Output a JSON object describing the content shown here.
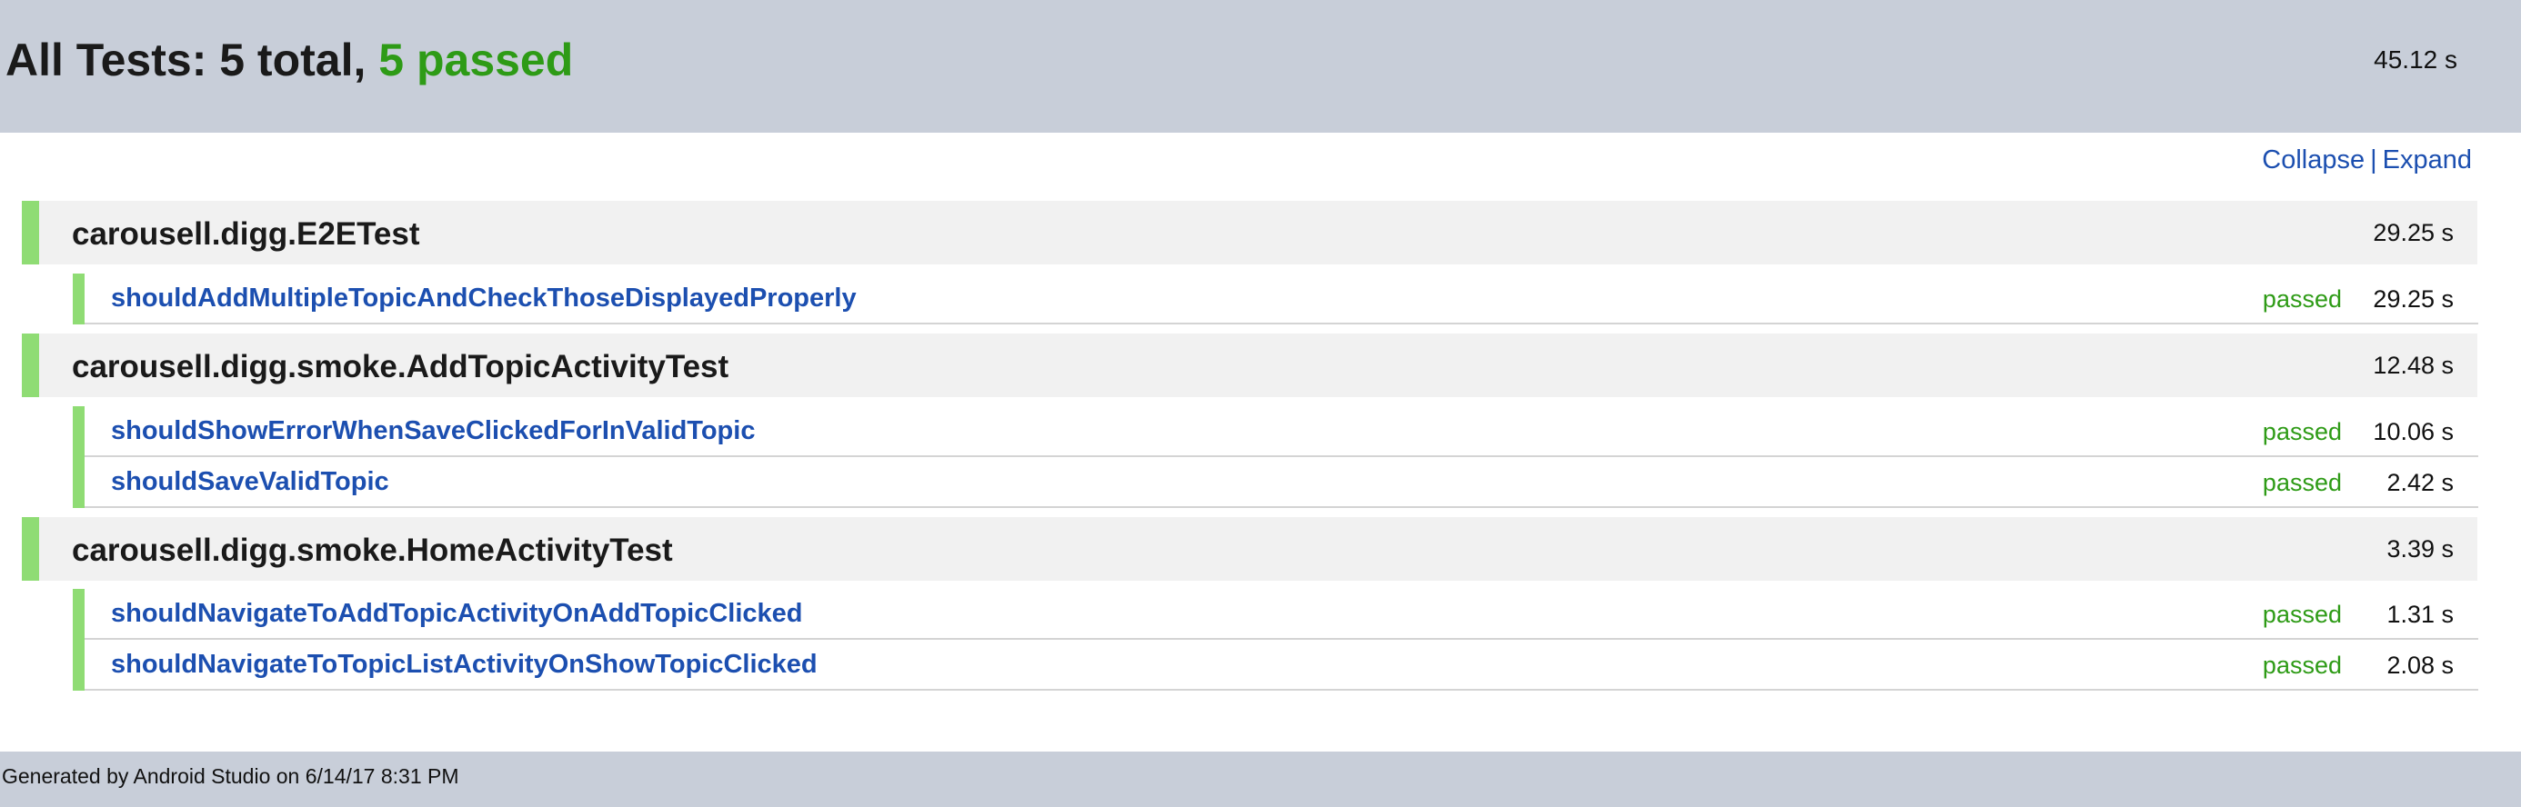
{
  "header": {
    "title_prefix": "All Tests: 5 total, ",
    "title_passed": "5 passed",
    "total_time": "45.12 s"
  },
  "controls": {
    "collapse": "Collapse",
    "separator": "|",
    "expand": "Expand"
  },
  "colors": {
    "passed": "#2e9b16",
    "link": "#1c4fb0",
    "status_bar": "#8fdc74",
    "header_bg": "#c8ced9"
  },
  "suites": [
    {
      "name": "carousell.digg.E2ETest",
      "time": "29.25 s",
      "tests": [
        {
          "name": "shouldAddMultipleTopicAndCheckThoseDisplayedProperly",
          "status": "passed",
          "time": "29.25 s"
        }
      ]
    },
    {
      "name": "carousell.digg.smoke.AddTopicActivityTest",
      "time": "12.48 s",
      "tests": [
        {
          "name": "shouldShowErrorWhenSaveClickedForInValidTopic",
          "status": "passed",
          "time": "10.06 s"
        },
        {
          "name": "shouldSaveValidTopic",
          "status": "passed",
          "time": "2.42 s"
        }
      ]
    },
    {
      "name": "carousell.digg.smoke.HomeActivityTest",
      "time": "3.39 s",
      "tests": [
        {
          "name": "shouldNavigateToAddTopicActivityOnAddTopicClicked",
          "status": "passed",
          "time": "1.31 s"
        },
        {
          "name": "shouldNavigateToTopicListActivityOnShowTopicClicked",
          "status": "passed",
          "time": "2.08 s"
        }
      ]
    }
  ],
  "footer": {
    "text": "Generated by Android Studio on 6/14/17 8:31 PM"
  }
}
